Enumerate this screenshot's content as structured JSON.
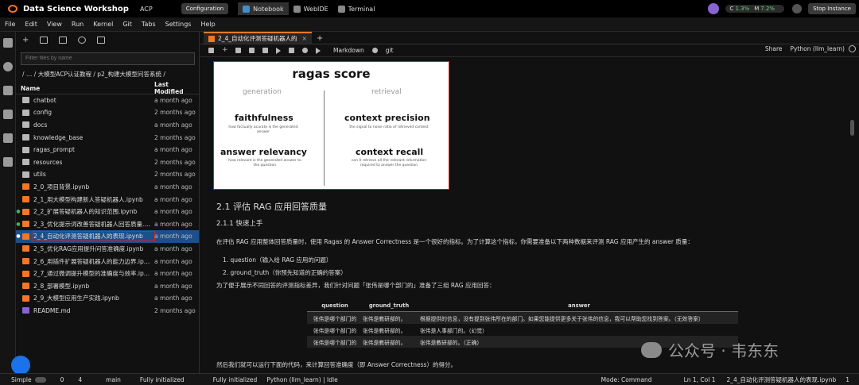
{
  "topbar": {
    "title": "Data Science Workshop",
    "product": "ACP",
    "configuration": "Configuration",
    "tabs": [
      "Notebook",
      "WebIDE",
      "Terminal"
    ],
    "cpu_label": "C",
    "cpu_value": "1.3%",
    "mem_label": "M",
    "mem_value": "7.2%",
    "stop": "Stop Instance"
  },
  "menu": [
    "File",
    "Edit",
    "View",
    "Run",
    "Kernel",
    "Git",
    "Tabs",
    "Settings",
    "Help"
  ],
  "sidebar": {
    "filter_placeholder": "Filter files by name",
    "breadcrumb": "/ … / 大模型ACP认证教程 / p2_构建大模型问答系统 /",
    "col_name": "Name",
    "col_modified": "Last Modified",
    "files": [
      {
        "name": "chatbot",
        "type": "folder",
        "modified": "a month ago",
        "running": false
      },
      {
        "name": "config",
        "type": "folder",
        "modified": "2 months ago",
        "running": false
      },
      {
        "name": "docs",
        "type": "folder",
        "modified": "a month ago",
        "running": false
      },
      {
        "name": "knowledge_base",
        "type": "folder",
        "modified": "2 months ago",
        "running": false
      },
      {
        "name": "ragas_prompt",
        "type": "folder",
        "modified": "a month ago",
        "running": false
      },
      {
        "name": "resources",
        "type": "folder",
        "modified": "2 months ago",
        "running": false
      },
      {
        "name": "utils",
        "type": "folder",
        "modified": "2 months ago",
        "running": false
      },
      {
        "name": "2_0_项目背景.ipynb",
        "type": "notebook",
        "modified": "a month ago",
        "running": false
      },
      {
        "name": "2_1_用大模型构建新人答疑机器人.ipynb",
        "type": "notebook",
        "modified": "a month ago",
        "running": false
      },
      {
        "name": "2_2_扩展答疑机器人的知识范围.ipynb",
        "type": "notebook",
        "modified": "a month ago",
        "running": true
      },
      {
        "name": "2_3_优化提示词改善答疑机器人回答质量.ipynb",
        "type": "notebook",
        "modified": "a month ago",
        "running": true
      },
      {
        "name": "2_4_自动化评测答疑机器人的表现.ipynb",
        "type": "notebook",
        "modified": "a month ago",
        "running": true,
        "selected": true
      },
      {
        "name": "2_5_优化RAG应用提升问答准确度.ipynb",
        "type": "notebook",
        "modified": "a month ago",
        "running": false
      },
      {
        "name": "2_6_用插件扩展答疑机器人的能力边界.ipynb",
        "type": "notebook",
        "modified": "a month ago",
        "running": false
      },
      {
        "name": "2_7_通过微调提升模型的准确度与效率.ipynb",
        "type": "notebook",
        "modified": "a month ago",
        "running": false
      },
      {
        "name": "2_8_部署模型.ipynb",
        "type": "notebook",
        "modified": "a month ago",
        "running": false
      },
      {
        "name": "2_9_大模型应用生产实践.ipynb",
        "type": "notebook",
        "modified": "a month ago",
        "running": false
      },
      {
        "name": "README.md",
        "type": "markdown",
        "modified": "2 months ago",
        "running": false
      }
    ]
  },
  "notebook": {
    "tab_title": "2_4_自动化评测答疑机器人的",
    "cell_type": "Markdown",
    "git": "git",
    "share": "Share",
    "kernel": "Python (llm_learn)"
  },
  "ragas_figure": {
    "title": "ragas score",
    "generation": "generation",
    "retrieval": "retrieval",
    "metrics": [
      {
        "name": "faithfulness",
        "desc": "how factually acurate is the generated answer"
      },
      {
        "name": "context precision",
        "desc": "the signal to noise ratio of retrieved context"
      },
      {
        "name": "answer relevancy",
        "desc": "how relevant is the generated answer to the question"
      },
      {
        "name": "context recall",
        "desc": "can it retrieve all the relevant information required to answer the question"
      }
    ]
  },
  "doc": {
    "h2": "2.1 评估 RAG 应用回答质量",
    "h3": "2.1.1 快速上手",
    "p1": "在评估 RAG 应用整体回答质量时，使用 Ragas 的 Answer Correctness 是一个很好的指标。为了计算这个指标，你需要准备以下两种数据来评测 RAG 应用产生的 answer 质量：",
    "li1": "1. question（输入给 RAG 应用的问题）",
    "li2": "2. ground_truth（你预先知道的正确的答案）",
    "p2": "为了便于展示不同回答的评测指标差异，我们针对问题「张伟是哪个部门的」准备了三组 RAG 应用回答：",
    "table": {
      "headers": [
        "question",
        "ground_truth",
        "answer"
      ],
      "rows": [
        [
          "张伟是哪个部门的",
          "张伟是教研部的。",
          "根据提供的信息，没有提到张伟所在的部门。如果您能提供更多关于张伟的信息，我可以帮助您找到答案。（无效答案）"
        ],
        [
          "张伟是哪个部门的",
          "张伟是教研部的。",
          "张伟是人事部门的。（幻觉）"
        ],
        [
          "张伟是哪个部门的",
          "张伟是教研部的。",
          "张伟是教研部的。（正确）"
        ]
      ]
    },
    "p3": "然后我们就可以运行下面的代码，来计算回答准确度（即 Answer Correctness）的得分。"
  },
  "watermark": "公众号 · 韦东东",
  "statusbar": {
    "simple": "Simple",
    "terminals": "0",
    "kernels": "4",
    "branch": "main",
    "init1": "Fully initialized",
    "init2": "Fully initialized",
    "kernel_status": "Python (llm_learn) | Idle",
    "mode": "Mode: Command",
    "position": "Ln 1, Col 1",
    "file": "2_4_自动化评测答疑机器人的表现.ipynb",
    "count": "1"
  },
  "colors": {
    "accent": "#f37726",
    "selection": "#1d4f8b",
    "highlight_box": "#c8231c",
    "running": "#3fb950"
  }
}
